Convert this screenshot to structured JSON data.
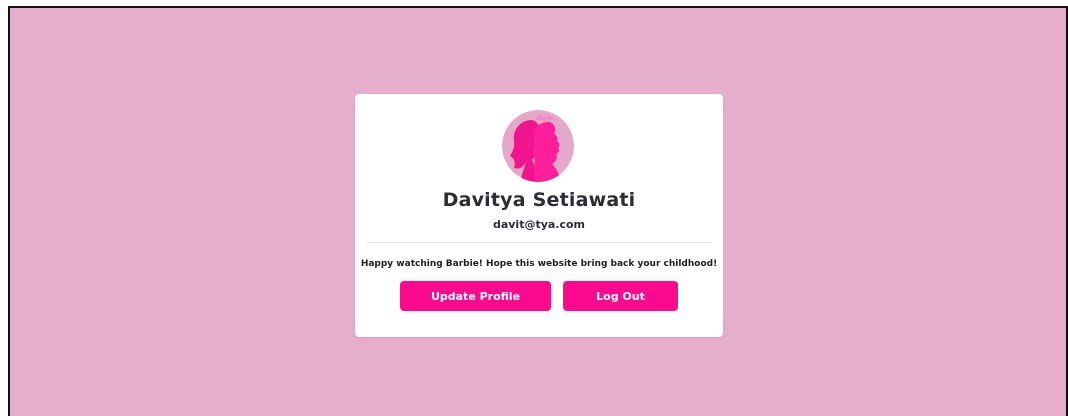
{
  "profile": {
    "name": "Davitya Setiawati",
    "email": "davit@tya.com",
    "message": "Happy watching Barbie! Hope this website bring back your childhood!",
    "avatar_icon": "barbie-silhouette-icon"
  },
  "actions": {
    "update_label": "Update Profile",
    "logout_label": "Log Out"
  },
  "colors": {
    "page_background": "#e6aecd",
    "card_background": "#ffffff",
    "accent": "#fb0a8f",
    "avatar_background": "#e4a8c8",
    "text": "#2c2c34"
  }
}
